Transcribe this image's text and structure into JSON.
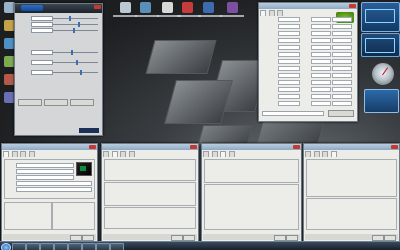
{
  "colors": {
    "titlebar": "#b9cde0",
    "gigabyte_header": "#1c232a",
    "nvidia_green": "#76b900",
    "amd_green": "#0d8b41",
    "taskbar": "#1c2533",
    "gadget_blue": "#1d4f86"
  },
  "oc_panel": {
    "slider_levels": [
      0.35,
      0.55,
      0.45,
      0.4,
      0.5,
      0.6
    ]
  },
  "gpuz": {
    "rows": 13
  },
  "cpuz_windows": [
    {
      "active_tab": 0
    },
    {
      "active_tab": 1
    },
    {
      "active_tab": 2
    },
    {
      "active_tab": 4
    }
  ],
  "icons": [
    "desktop-icon",
    "taskbar-app-icon",
    "start-orb-icon",
    "gadget-gauge-icon",
    "close-icon"
  ]
}
